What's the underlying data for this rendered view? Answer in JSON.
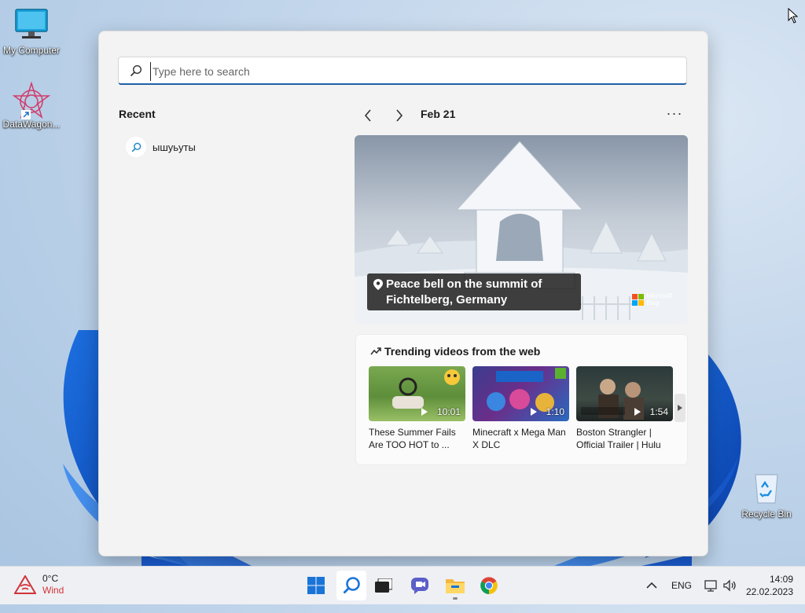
{
  "desktop": {
    "icons": [
      {
        "label": "My Computer"
      },
      {
        "label": "DataWagon..."
      },
      {
        "label": "Recycle Bin"
      }
    ]
  },
  "search": {
    "placeholder": "Type here to search",
    "value": ""
  },
  "recent": {
    "title": "Recent",
    "items": [
      {
        "label": "ышуьуты",
        "icon": "search-icon"
      }
    ]
  },
  "highlights": {
    "date": "Feb 21",
    "more_label": "···",
    "hero": {
      "caption_line1": "Peace bell on the summit of",
      "caption_line2": "Fichtelberg, Germany",
      "brand_line1": "Microsoft",
      "brand_line2": "Bing"
    }
  },
  "trending": {
    "title": "Trending videos from the web",
    "videos": [
      {
        "title_line1": "These Summer Fails",
        "title_line2": "Are TOO HOT to ...",
        "duration": "10:01"
      },
      {
        "title_line1": "Minecraft x Mega Man",
        "title_line2": "X DLC",
        "duration": "1:10"
      },
      {
        "title_line1": "Boston Strangler |",
        "title_line2": "Official Trailer | Hulu",
        "duration": "1:54"
      }
    ]
  },
  "taskbar": {
    "weather_temp": "0°C",
    "weather_desc": "Wind",
    "language": "ENG",
    "time": "14:09",
    "date": "22.02.2023"
  },
  "colors": {
    "accent": "#1f5fa8",
    "weather_alert": "#d13438"
  }
}
